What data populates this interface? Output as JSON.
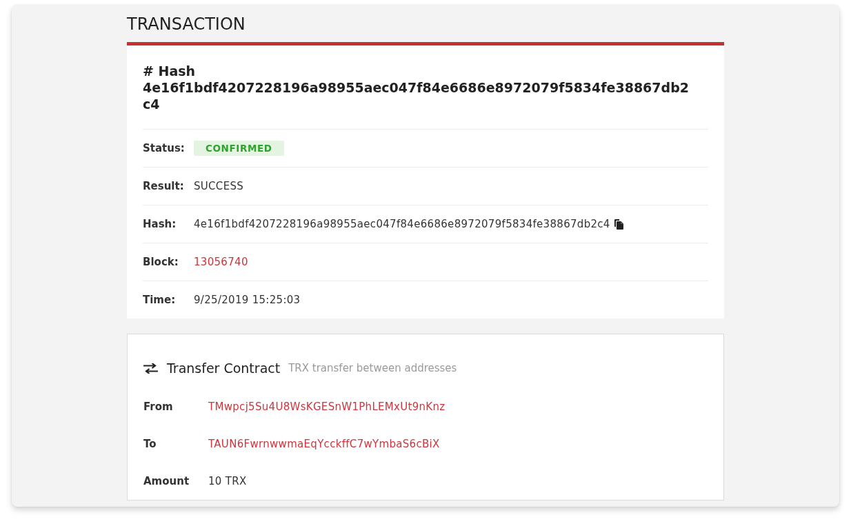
{
  "page": {
    "title": "TRANSACTION"
  },
  "transaction": {
    "heading": "# Hash",
    "hash": "4e16f1bdf4207228196a98955aec047f84e6686e8972079f5834fe38867db2c4",
    "fields": [
      {
        "kind": "status",
        "label": "Status:",
        "value": "CONFIRMED"
      },
      {
        "kind": "text",
        "label": "Result:",
        "value": "SUCCESS"
      },
      {
        "kind": "copyable",
        "label": "Hash:",
        "value": "4e16f1bdf4207228196a98955aec047f84e6686e8972079f5834fe38867db2c4"
      },
      {
        "kind": "link",
        "label": "Block:",
        "value": "13056740"
      },
      {
        "kind": "text",
        "label": "Time:",
        "value": "9/25/2019 15:25:03"
      }
    ]
  },
  "contract": {
    "title": "Transfer Contract",
    "subtitle": "TRX transfer between addresses",
    "fields": [
      {
        "kind": "link",
        "label": "From",
        "value": "TMwpcj5Su4U8WsKGESnW1PhLEMxUt9nKnz"
      },
      {
        "kind": "link",
        "label": "To",
        "value": "TAUN6FwrnwwmaEqYcckffC7wYmbaS6cBiX"
      },
      {
        "kind": "text",
        "label": "Amount",
        "value": "10 TRX"
      }
    ]
  }
}
